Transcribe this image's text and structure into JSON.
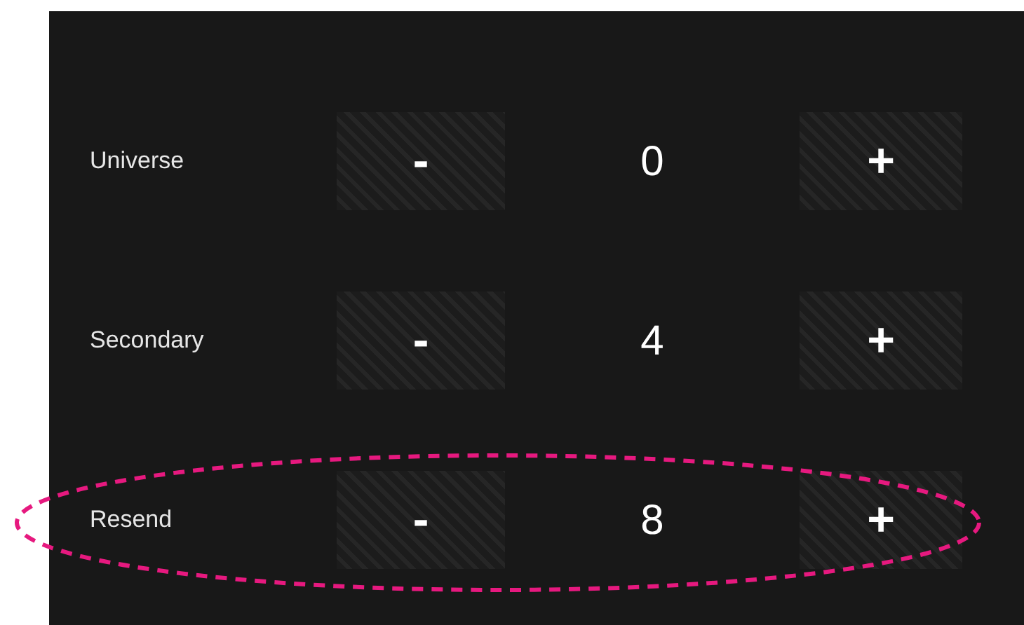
{
  "rows": [
    {
      "label": "Universe",
      "decrement": "-",
      "value": "0",
      "increment": "+",
      "highlighted": false
    },
    {
      "label": "Secondary",
      "decrement": "-",
      "value": "4",
      "increment": "+",
      "highlighted": false
    },
    {
      "label": "Resend",
      "decrement": "-",
      "value": "8",
      "increment": "+",
      "highlighted": true
    }
  ]
}
